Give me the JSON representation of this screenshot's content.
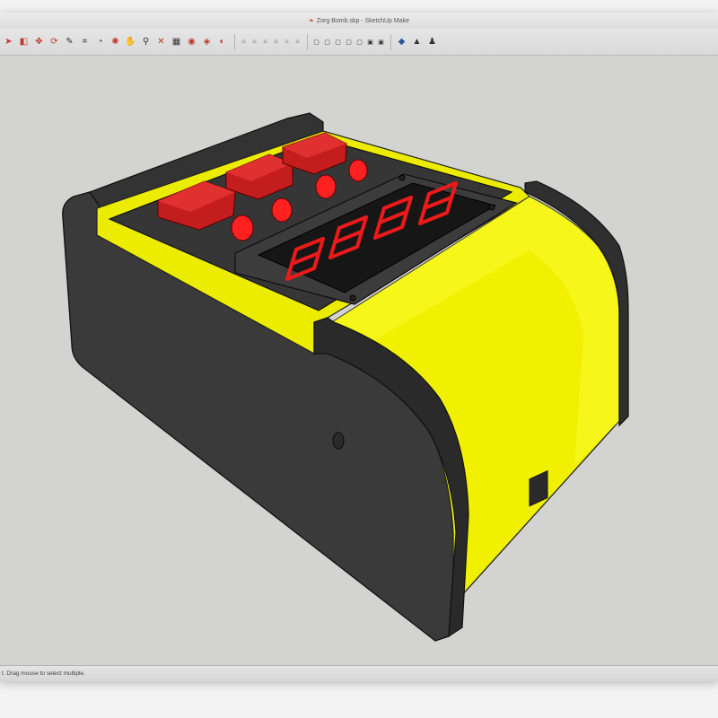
{
  "window": {
    "title": "Zorg Bomb.skp - SketchUp Make"
  },
  "toolbar": {
    "tools": [
      {
        "name": "select-tool",
        "icon": "arrow-icon",
        "glyph": "➤",
        "tone": "red"
      },
      {
        "name": "eraser-tool",
        "icon": "eraser-icon",
        "glyph": "◧",
        "tone": "red"
      },
      {
        "name": "move-tool",
        "icon": "move-icon",
        "glyph": "✥",
        "tone": "red"
      },
      {
        "name": "rotate-tool",
        "icon": "rotate-icon",
        "glyph": "⟳",
        "tone": "red"
      },
      {
        "name": "tape-tool",
        "icon": "tape-measure-icon",
        "glyph": "✎",
        "tone": "dark"
      },
      {
        "name": "text-tool",
        "icon": "text-icon",
        "glyph": "⌗",
        "tone": "dark"
      },
      {
        "name": "protractor-tool",
        "icon": "protractor-icon",
        "glyph": "◔",
        "tone": "dark"
      },
      {
        "name": "orbit-tool",
        "icon": "orbit-icon",
        "glyph": "✺",
        "tone": "red"
      },
      {
        "name": "pan-tool",
        "icon": "pan-icon",
        "glyph": "✋",
        "tone": "dark"
      },
      {
        "name": "zoom-tool",
        "icon": "zoom-icon",
        "glyph": "⚲",
        "tone": "dark"
      },
      {
        "name": "zoom-extents-tool",
        "icon": "zoom-extents-icon",
        "glyph": "✕",
        "tone": "red"
      },
      {
        "name": "warehouse-tool",
        "icon": "warehouse-icon",
        "glyph": "▦",
        "tone": "dark"
      },
      {
        "name": "extension-tool",
        "icon": "extension-icon",
        "glyph": "◉",
        "tone": "red"
      },
      {
        "name": "components-tool",
        "icon": "components-icon",
        "glyph": "◈",
        "tone": "red"
      },
      {
        "name": "materials-tool",
        "icon": "paint-bucket-icon",
        "glyph": "◐",
        "tone": "red"
      }
    ],
    "view_tools": [
      {
        "name": "view-iso",
        "icon": "house-iso-icon",
        "glyph": "⌂"
      },
      {
        "name": "view-top",
        "icon": "house-top-icon",
        "glyph": "⌂"
      },
      {
        "name": "view-front",
        "icon": "house-front-icon",
        "glyph": "⌂"
      },
      {
        "name": "view-right",
        "icon": "house-right-icon",
        "glyph": "⌂"
      },
      {
        "name": "view-back",
        "icon": "house-back-icon",
        "glyph": "⌂"
      },
      {
        "name": "view-left",
        "icon": "house-left-icon",
        "glyph": "⌂"
      }
    ],
    "style_tools": [
      {
        "name": "style-xray",
        "icon": "xray-icon",
        "glyph": "▢"
      },
      {
        "name": "style-backedges",
        "icon": "backedges-icon",
        "glyph": "▢"
      },
      {
        "name": "style-wireframe",
        "icon": "wireframe-icon",
        "glyph": "▢"
      },
      {
        "name": "style-hidden-line",
        "icon": "hidden-line-icon",
        "glyph": "▢"
      },
      {
        "name": "style-shaded",
        "icon": "shaded-icon",
        "glyph": "▢"
      },
      {
        "name": "style-textured",
        "icon": "textured-icon",
        "glyph": "▣"
      },
      {
        "name": "style-monochrome",
        "icon": "monochrome-icon",
        "glyph": "▣"
      }
    ],
    "extra_tools": [
      {
        "name": "sandbox-tool",
        "icon": "sandbox-icon",
        "glyph": "◆",
        "tone": "blue"
      },
      {
        "name": "position-camera-tool",
        "icon": "camera-icon",
        "glyph": "▲",
        "tone": "dark"
      },
      {
        "name": "walk-tool",
        "icon": "walk-icon",
        "glyph": "♟",
        "tone": "dark"
      }
    ]
  },
  "status": {
    "text": "t. Drag mouse to select multiple."
  },
  "model": {
    "display_digits": "88:88",
    "colors": {
      "body": "#3a3a3a",
      "accent": "#f2f200",
      "button": "#c81e1e",
      "led": "#ff1a1a",
      "background": "#d3d3d1"
    }
  }
}
